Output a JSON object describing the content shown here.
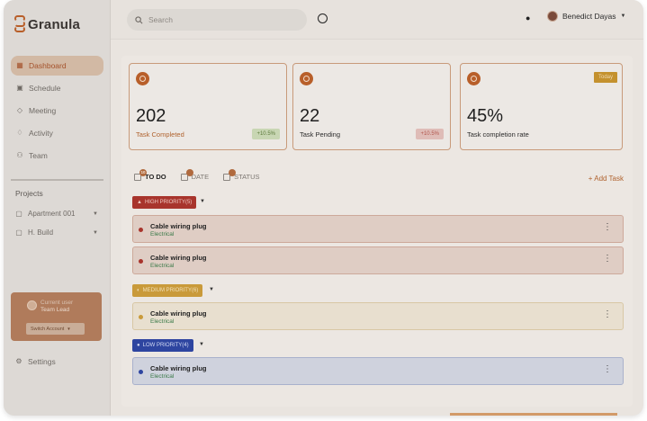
{
  "app": {
    "name": "Granula"
  },
  "sidebar": {
    "nav": [
      {
        "label": "Dashboard",
        "icon": "grid-icon",
        "active": true
      },
      {
        "label": "Schedule",
        "icon": "calendar-icon",
        "active": false
      },
      {
        "label": "Meeting",
        "icon": "tag-icon",
        "active": false
      },
      {
        "label": "Activity",
        "icon": "activity-icon",
        "active": false
      },
      {
        "label": "Team",
        "icon": "team-icon",
        "active": false
      }
    ],
    "projects_title": "Projects",
    "projects": [
      {
        "label": "Apartment 001"
      },
      {
        "label": "H. Build"
      }
    ],
    "user_card": {
      "line1": "Current user",
      "line2": "Team Lead",
      "switch_label": "Switch Account"
    },
    "settings_label": "Settings"
  },
  "topbar": {
    "search_placeholder": "Search",
    "user_name": "Benedict Dayas"
  },
  "stats": [
    {
      "value": "202",
      "label": "Task Completed",
      "badge": "+10.5%",
      "badge_type": "positive"
    },
    {
      "value": "22",
      "label": "Task Pending",
      "badge": "+10.5%",
      "badge_type": "negative"
    },
    {
      "value": "45%",
      "label": "Task completion rate",
      "tag": "Today"
    }
  ],
  "tabs": [
    {
      "label": "TO DO",
      "count": "10",
      "active": true
    },
    {
      "label": "DATE",
      "count": "",
      "active": false
    },
    {
      "label": "STATUS",
      "count": "",
      "active": false
    }
  ],
  "add_task_label": "+ Add Task",
  "groups": [
    {
      "label": "HIGH PRIORITY(5)",
      "color": "#a8342c",
      "tasks": [
        {
          "title": "Cable wiring plug",
          "sub": "Electrical"
        },
        {
          "title": "Cable wiring plug",
          "sub": "Electrical"
        }
      ]
    },
    {
      "label": "MEDIUM PRIORITY(6)",
      "color": "#c99a3a",
      "tasks": [
        {
          "title": "Cable wiring plug",
          "sub": "Electrical"
        }
      ]
    },
    {
      "label": "LOW PRIORITY(4)",
      "color": "#2e45a0",
      "tasks": [
        {
          "title": "Cable wiring plug",
          "sub": "Electrical"
        }
      ]
    }
  ],
  "colors": {
    "accent": "#b85f2a",
    "sidebar_bg": "#ddd9d5",
    "main_bg": "#ece7e2"
  }
}
